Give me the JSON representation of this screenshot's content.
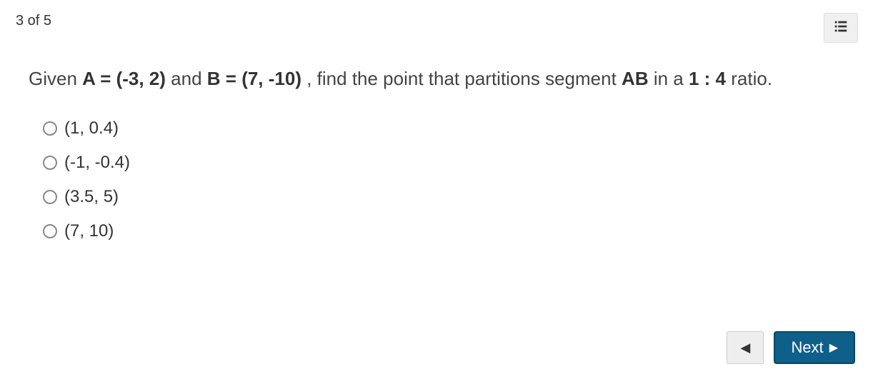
{
  "header": {
    "progress": "3 of 5"
  },
  "question": {
    "prefix": "Given ",
    "a_label": "A = (-3, 2)",
    "and_text": " and ",
    "b_label": "B = (7, -10)",
    "mid_text": " , find the point that partitions segment ",
    "segment": "AB",
    "mid_text2": "  in a ",
    "ratio": "1 : 4",
    "suffix": " ratio."
  },
  "options": [
    {
      "label": "(1, 0.4)"
    },
    {
      "label": "(-1, -0.4)"
    },
    {
      "label": "(3.5, 5)"
    },
    {
      "label": "(7, 10)"
    }
  ],
  "nav": {
    "next_label": "Next"
  }
}
